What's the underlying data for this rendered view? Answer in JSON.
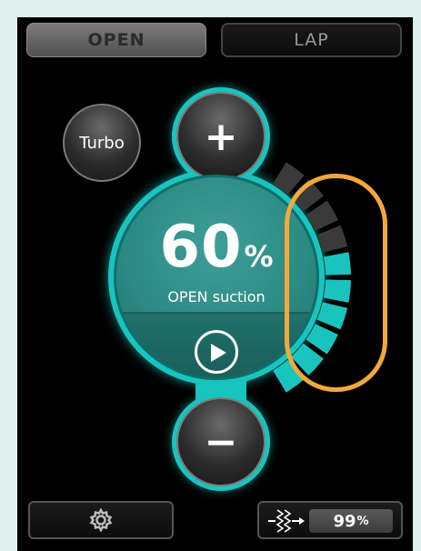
{
  "tabs": [
    {
      "label": "OPEN",
      "active": true
    },
    {
      "label": "LAP",
      "active": false
    }
  ],
  "turbo": {
    "label": "Turbo"
  },
  "controls": {
    "increase_symbol": "+",
    "decrease_symbol": "−"
  },
  "suction": {
    "value": "60",
    "unit": "%",
    "mode_label": "OPEN suction",
    "level_fraction": 0.6
  },
  "play": {
    "icon": "play-icon"
  },
  "settings": {
    "icon": "gear-icon"
  },
  "flow": {
    "icon": "flow-sensor-icon",
    "value": "99",
    "unit": "%"
  },
  "colors": {
    "accent": "#19c4bf",
    "highlight": "#f2a83a",
    "background": "#000000",
    "frame": "#dff0ee"
  }
}
